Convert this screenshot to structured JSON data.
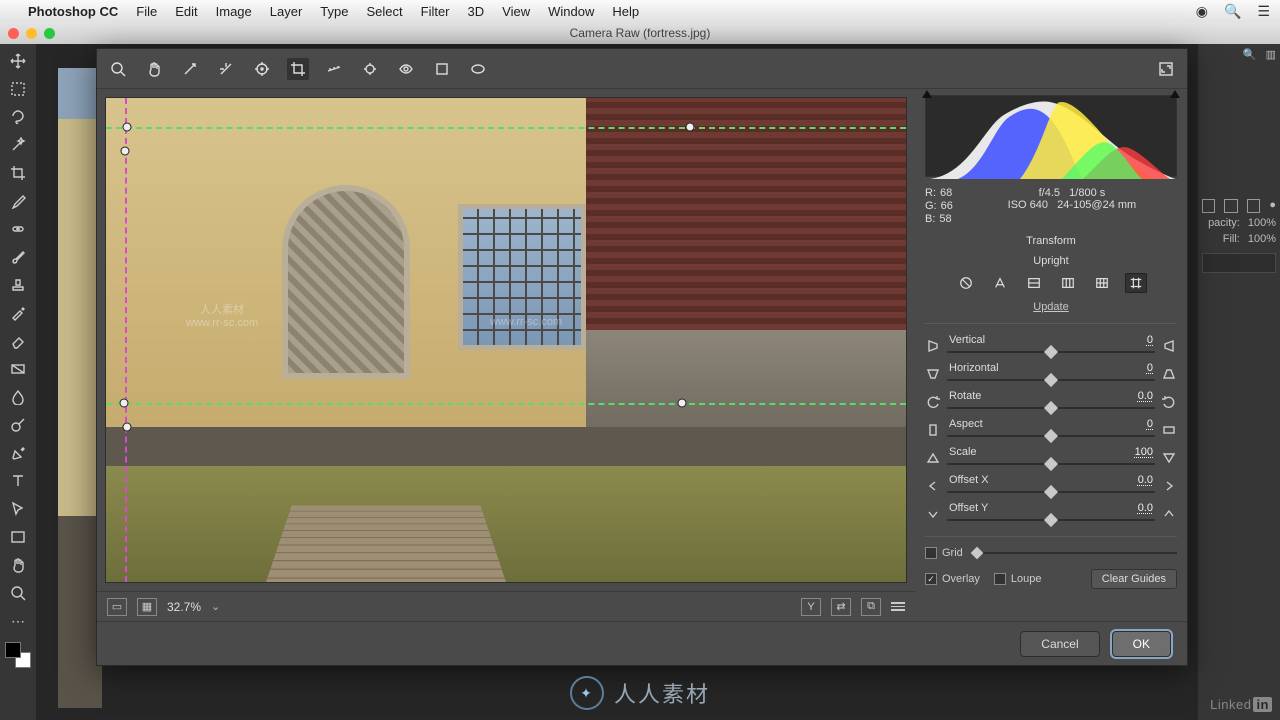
{
  "menubar": {
    "app": "Photoshop CC",
    "items": [
      "File",
      "Edit",
      "Image",
      "Layer",
      "Type",
      "Select",
      "Filter",
      "3D",
      "View",
      "Window",
      "Help"
    ]
  },
  "window": {
    "title": "Camera Raw (fortress.jpg)"
  },
  "footer": {
    "zoom": "32.7%"
  },
  "rgb": {
    "r_lbl": "R:",
    "r": "68",
    "g_lbl": "G:",
    "g": "66",
    "b_lbl": "B:",
    "b": "58"
  },
  "exif": {
    "aperture": "f/4.5",
    "shutter": "1/800 s",
    "iso": "ISO 640",
    "lens": "24-105@24 mm"
  },
  "panel": {
    "section": "Transform",
    "upright": "Upright",
    "update": "Update"
  },
  "sliders": {
    "vertical": {
      "label": "Vertical",
      "value": "0",
      "pos": 50
    },
    "horizontal": {
      "label": "Horizontal",
      "value": "0",
      "pos": 50
    },
    "rotate": {
      "label": "Rotate",
      "value": "0.0",
      "pos": 50
    },
    "aspect": {
      "label": "Aspect",
      "value": "0",
      "pos": 50
    },
    "scale": {
      "label": "Scale",
      "value": "100",
      "pos": 50
    },
    "offx": {
      "label": "Offset X",
      "value": "0.0",
      "pos": 50
    },
    "offy": {
      "label": "Offset Y",
      "value": "0.0",
      "pos": 50
    }
  },
  "checks": {
    "grid": "Grid",
    "overlay": "Overlay",
    "loupe": "Loupe",
    "clear": "Clear Guides"
  },
  "buttons": {
    "cancel": "Cancel",
    "ok": "OK"
  },
  "ps_panel": {
    "opacity_lbl": "pacity:",
    "opacity": "100%",
    "fill_lbl": "Fill:",
    "fill": "100%"
  },
  "wm": {
    "brand": "人人素材",
    "url": "www.rr-sc.com",
    "linkedin": "Linked",
    "in": "in"
  }
}
